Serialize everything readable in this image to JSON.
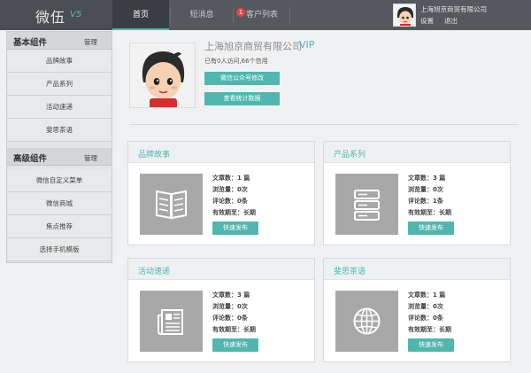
{
  "app": {
    "logo_text": "微伍",
    "logo_version": "V5"
  },
  "nav_tabs": [
    {
      "label": "首页",
      "active": true
    },
    {
      "label": "短消息",
      "active": false
    },
    {
      "label": "客户列表",
      "active": false,
      "badge": "1"
    }
  ],
  "user": {
    "company": "上海旭京商贸有限公司",
    "settings": "设置",
    "logout": "退出"
  },
  "sidebar": {
    "sections": [
      {
        "title": "基本组件",
        "manage": "管理",
        "items": [
          "品牌故事",
          "产品系列",
          "活动速递",
          "斐思茶语"
        ]
      },
      {
        "title": "高级组件",
        "manage": "管理",
        "items": [
          "微信自定义菜单",
          "微信商城",
          "焦点推荐",
          "选择手机模版"
        ]
      }
    ]
  },
  "profile": {
    "company": "上海旭京商贸有限公司",
    "vip": "VIP",
    "stats": "已有0人访问,66个信用",
    "btn_edit": "微信公众号修改",
    "btn_stats": "查看统计数据"
  },
  "cards": [
    {
      "title": "品牌故事",
      "icon": "book-icon",
      "articles": "文章数：1 篇",
      "views": "浏览量：0次",
      "comments": "评论数：0条",
      "expiry": "有效期至：长期",
      "button": "快速发布"
    },
    {
      "title": "产品系列",
      "icon": "server-icon",
      "articles": "文章数：3 篇",
      "views": "浏览量：0次",
      "comments": "评论数：1条",
      "expiry": "有效期至：长期",
      "button": "快速发布"
    },
    {
      "title": "活动速递",
      "icon": "newspaper-icon",
      "articles": "文章数：3 篇",
      "views": "浏览量：0次",
      "comments": "评论数：0条",
      "expiry": "有效期至：长期",
      "button": "快速发布"
    },
    {
      "title": "斐思茶语",
      "icon": "globe-icon",
      "articles": "文章数：1 篇",
      "views": "浏览量：0次",
      "comments": "评论数：0条",
      "expiry": "有效期至：长期",
      "button": "快速发布"
    }
  ],
  "colors": {
    "accent": "#4fb7ad",
    "topbar": "#55595e",
    "badge": "#e04848"
  }
}
